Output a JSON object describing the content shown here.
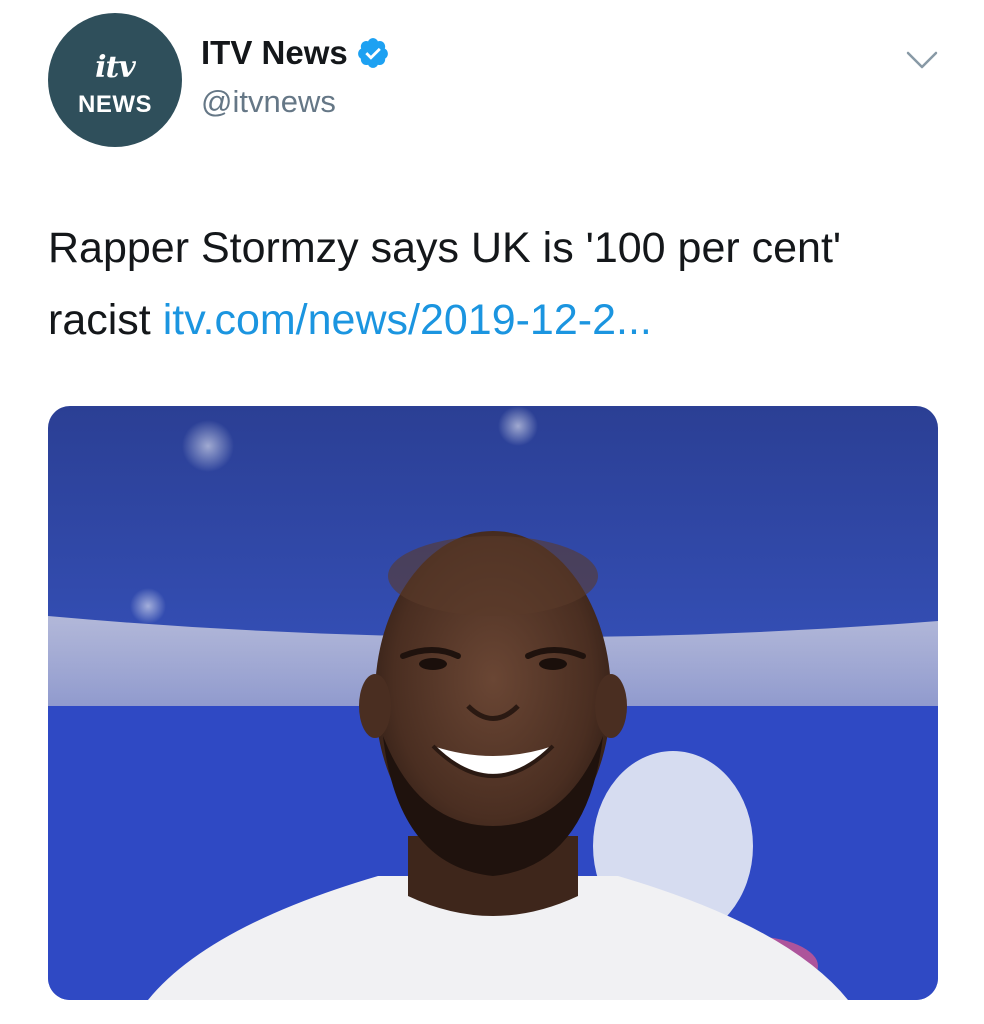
{
  "account": {
    "avatar_text_top": "itv",
    "avatar_text_bottom": "NEWS",
    "display_name": "ITV News",
    "handle": "@itvnews",
    "verified": true,
    "avatar_color": "#2f4f5b"
  },
  "tweet": {
    "text": "Rapper Stormzy says UK is '100 per cent' racist ",
    "link_text": "itv.com/news/2019-12-2...",
    "link_color": "#1b95e0"
  },
  "icons": {
    "verified": "verified-badge-icon",
    "more": "chevron-down-icon"
  },
  "colors": {
    "text_primary": "#14171a",
    "text_secondary": "#657786",
    "verified_blue": "#1da1f2"
  }
}
